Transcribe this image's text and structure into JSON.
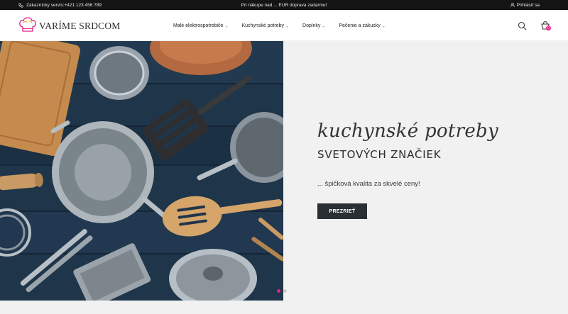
{
  "topbar": {
    "phone_text": "Zákaznícky servis:+421 123 456 789",
    "promo_text": "Pri nákupe nad ... EUR doprava zadarmo!",
    "login_text": "Prihlásiť sa"
  },
  "header": {
    "logo_text": "VARÍME SRDCOM",
    "nav": [
      {
        "label": "Malé elektrospotrebiče"
      },
      {
        "label": "Kuchynské potreby"
      },
      {
        "label": "Doplnky"
      },
      {
        "label": "Pečenie a zákusky"
      }
    ],
    "cart_count": "0"
  },
  "hero": {
    "script_title": "kuchynské potreby",
    "subtitle": "SVETOVÝCH ZNAČIEK",
    "tagline": "... špičková kvalita za skvelé ceny!",
    "button_label": "PREZRIEŤ",
    "slides": 2,
    "active_slide": 1
  },
  "colors": {
    "accent": "#e0218a",
    "topbar_bg": "#141414",
    "button_bg": "#2a2f33",
    "hero_bg": "#f1f1f1"
  },
  "icons": [
    "phone-icon",
    "user-icon",
    "logo-chef-hat-icon",
    "chevron-down-icon",
    "search-icon",
    "cart-icon"
  ]
}
